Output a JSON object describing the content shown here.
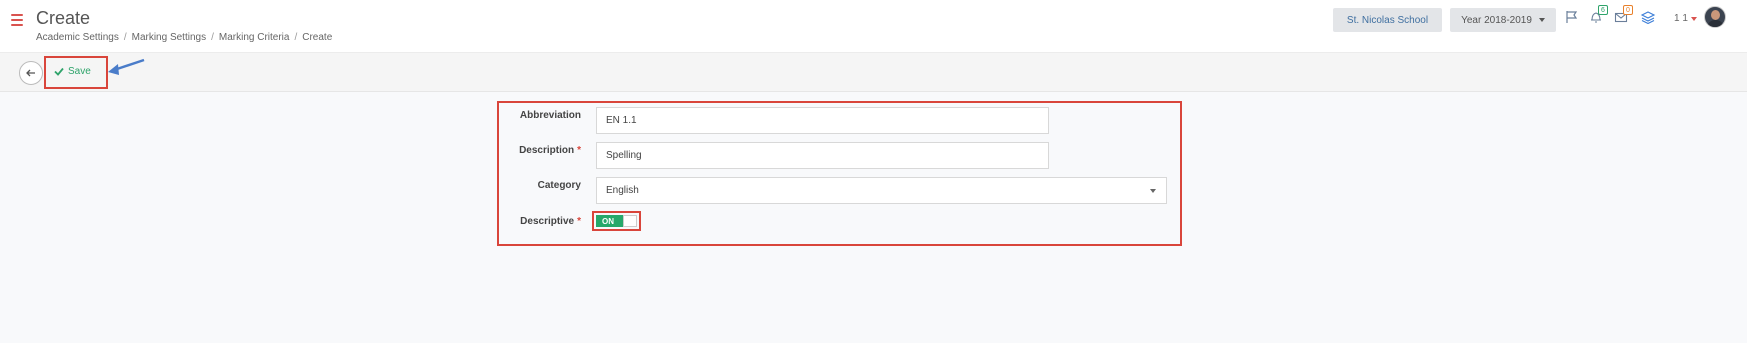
{
  "header": {
    "title": "Create",
    "breadcrumb": [
      "Academic Settings",
      "Marking Settings",
      "Marking Criteria",
      "Create"
    ],
    "school": "St. Nicolas School",
    "year": "Year 2018-2019",
    "notifications_count": "6",
    "messages_count": "0",
    "user": "1 1"
  },
  "toolbar": {
    "save_label": "Save"
  },
  "form": {
    "abbreviation_label": "Abbreviation",
    "abbreviation_value": "EN 1.1",
    "description_label": "Description",
    "description_value": "Spelling",
    "category_label": "Category",
    "category_value": "English",
    "descriptive_label": "Descriptive",
    "descriptive_state": "ON",
    "required_mark": "*"
  },
  "colors": {
    "accent_green": "#26a86a",
    "highlight_red": "#d9453b",
    "arrow_blue": "#4a7cc9"
  }
}
